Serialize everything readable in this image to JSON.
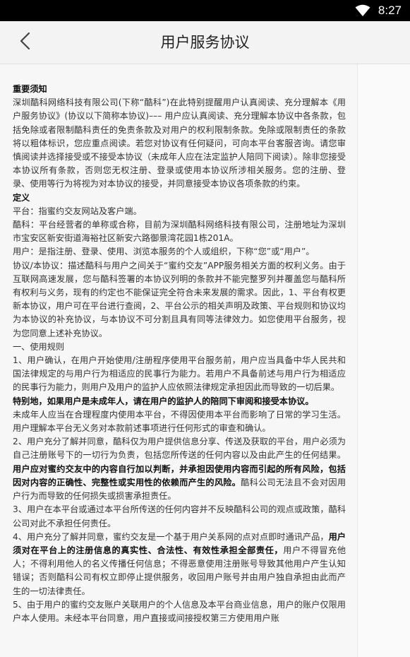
{
  "status_bar": {
    "time": "8:27",
    "icons": [
      "wifi-icon"
    ]
  },
  "header": {
    "title": "用户服务协议",
    "back_icon": "chevron-left-icon"
  },
  "document": {
    "notice_heading": "重要须知",
    "notice_body": "深圳酷科网络科技有限公司(下称“酷科”)在此特别提醒用户认真阅读、充分理解本《用户服务协议》(协议以下简称本协议)––– 用户应认真阅读、充分理解本协议中各条款，包括免除或者限制酷科责任的免责条款及对用户的权利限制条款。免除或限制责任的条款将以粗体标识，您应重点阅读。若您对协议有任何疑问，可向本平台客服咨询。请您审慎阅读并选择接受或不接受本协议（未成年人应在法定监护人陪同下阅读）。除非您接受本协议所有条款，否则您无权注册、登录或使用本协议所涉相关服务。您的注册、登录、使用等行为将视为对本协议的接受，并同意接受本协议各项条款的约束。",
    "definition_heading": "定义",
    "def_platform": "平台：指蜜约交友网站及客户端。",
    "def_kuke": "酷科：平台经营者的单称或合称，目前为深圳酷科网络科技有限公司，注册地址为深圳市宝安区新安街道海裕社区新安六路御景湾花园1栋201A。",
    "def_user": "用户：是指注册、登录、使用、浏览本服务的个人或组织，下称“您”或“用户”。",
    "def_agreement": "协议/本协议：描述酷科与用户之间关于“蜜约交友”APP服务相关方面的权利义务。由于互联网高速发展，您与酷科签署的本协议列明的条款并不能完整罗列并覆盖您与酷科所有权利与义务，现有的约定也不能保证完全符合未来发展的需求。因此，1、平台有权更新本协议，用户可在平台进行查阅，2、平台公示的相关声明及政策、平台规则和协议均为本协议的补充协议，与本协议不可分割且具有同等法律效力。如您使用平台服务，视为您同意上述补充协议。",
    "section1_heading": "一、使用规则",
    "rule1": "1、用户确认，在用户开始使用/注册程序使用平台服务前，用户应当具备中华人民共和国法律规定的与用户行为相适应的民事行为能力。若用户不具备前述与用户行为相适应的民事行为能力，则用户及用户的监护人应依照法律规定承担因此而导致的一切后果。",
    "rule1_bold": "特别地，如果用户是未成年人，请在用户的监护人的陪同下审阅和接受本协议。",
    "rule1_minor": "未成年人应当在合理程度内使用本平台，不得因使用本平台而影响了日常的学习生活。用户理解本平台无义务对本款前述事项进行任何形式的审查和确认。",
    "rule2_a": "2、用户充分了解并同意，酷科仅为用户提供信息分享、传送及获取的平台，用户必须为自己注册账号下的一切行为负责，包括您所传送的任何内容以及由此产生的任何结果。",
    "rule2_bold": "用户应对蜜约交友中的内容自行加以判断，并承担因使用内容而引起的所有风险，包括因对内容的正确性、完整性或实用性的依赖而产生的风险。",
    "rule2_c": "酷科公司无法且不会对因用户行为而导致的任何损失或损害承担责任。",
    "rule3": "3、用户在本平台或通过本平台所传送的任何内容并不反映酷科公司的观点或政策，酷科公司对此不承担任何责任。",
    "rule4_a": "4、用户充分了解并同意，蜜约交友是一个基于用户关系网的点对点即时通讯产品，",
    "rule4_bold": "用户须对在平台上的注册信息的真实性、合法性、有效性承担全部责任，",
    "rule4_c": "用户不得冒充他人；不得利用他人的名义传播任何信息；不得恶意使用注册账号导致其他用户产生认知错误；否则酷科公司有权立即停止提供服务，收回用户账号并由用户独自承担由此而产生的一切法律责任。",
    "rule5": "5、由于用户的蜜约交友账户关联用户的个人信息及本平台商业信息，用户的账户仅限用户本人使用。未经本平台同意，用户直接或间接授权第三方使用用户账"
  }
}
